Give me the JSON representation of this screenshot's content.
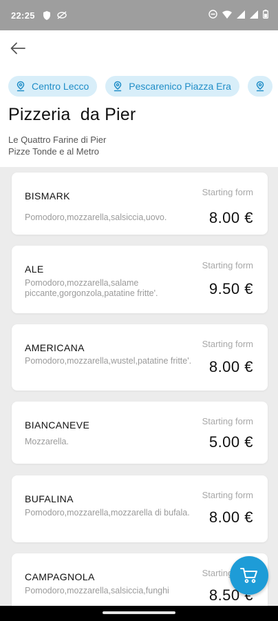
{
  "status_bar": {
    "time": "22:25"
  },
  "header": {
    "locations": [
      "Centro Lecco",
      "Pescarenico Piazza Era"
    ],
    "title": "Pizzeria  da Pier",
    "subtitle_line1": "Le Quattro Farine di Pier",
    "subtitle_line2": "Pizze Tonde e al Metro"
  },
  "menu": {
    "starting_label": "Starting form",
    "items": [
      {
        "name": "BISMARK",
        "desc": "Pomodoro,mozzarella,salsiccia,uovo.",
        "price": "8.00 €"
      },
      {
        "name": "ALE",
        "desc": "Pomodoro,mozzarella,salame piccante,gorgonzola,patatine fritte'.",
        "price": "9.50 €"
      },
      {
        "name": "AMERICANA",
        "desc": "Pomodoro,mozzarella,wustel,patatine fritte'.",
        "price": "8.00 €"
      },
      {
        "name": "BIANCANEVE",
        "desc": "Mozzarella.",
        "price": "5.00 €"
      },
      {
        "name": "BUFALINA",
        "desc": "Pomodoro,mozzarella,mozzarella di bufala.",
        "price": "8.00 €"
      },
      {
        "name": "CAMPAGNOLA",
        "desc": "Pomodoro,mozzarella,salsiccia,funghi",
        "price": "8.50 €"
      }
    ]
  },
  "colors": {
    "accent": "#1e9cd7",
    "chip_bg": "#d8eef9",
    "chip_text": "#1f8dc7"
  },
  "icons": [
    "back-arrow-icon",
    "location-pin-icon",
    "cart-icon"
  ]
}
